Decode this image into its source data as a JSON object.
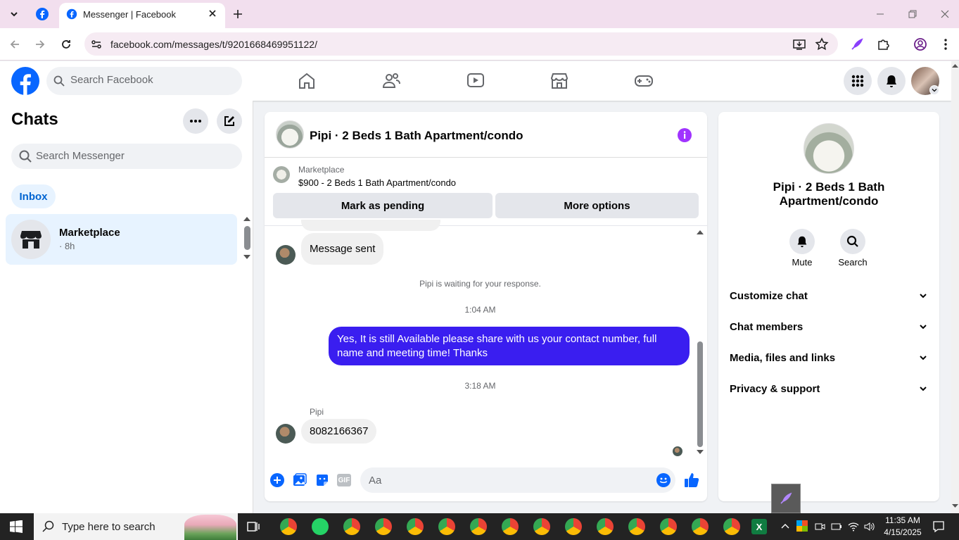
{
  "browser": {
    "tab_title": "Messenger | Facebook",
    "url": "facebook.com/messages/t/9201668469951122/"
  },
  "fb": {
    "search_placeholder": "Search Facebook"
  },
  "chats": {
    "title": "Chats",
    "search_placeholder": "Search Messenger",
    "filter": "Inbox",
    "items": [
      {
        "name": "Marketplace",
        "time": "· 8h"
      }
    ]
  },
  "conversation": {
    "title": "Pipi · 2 Beds 1 Bath Apartment/condo",
    "listing_source": "Marketplace",
    "listing_price": "$900 - 2 Beds 1 Bath Apartment/condo",
    "mark_pending": "Mark as pending",
    "more_options": "More options",
    "messages": {
      "sent_notice": "Message sent",
      "waiting": "Pipi is waiting for your response.",
      "time1": "1:04 AM",
      "outgoing": "Yes, It is still Available please share with us your contact number, full name and meeting time! Thanks",
      "time2": "3:18 AM",
      "sender": "Pipi",
      "incoming": "8082166367"
    },
    "composer_placeholder": "Aa",
    "gif_label": "GIF"
  },
  "info_panel": {
    "name": "Pipi · 2 Beds 1 Bath Apartment/condo",
    "mute": "Mute",
    "search": "Search",
    "sections": [
      "Customize chat",
      "Chat members",
      "Media, files and links",
      "Privacy & support"
    ]
  },
  "taskbar": {
    "search_placeholder": "Type here to search",
    "time": "11:35 AM",
    "date": "4/15/2025"
  },
  "colors": {
    "fb_blue": "#0866ff",
    "messenger_purple": "#3a1ef0",
    "info_icon": "#a033ff"
  }
}
